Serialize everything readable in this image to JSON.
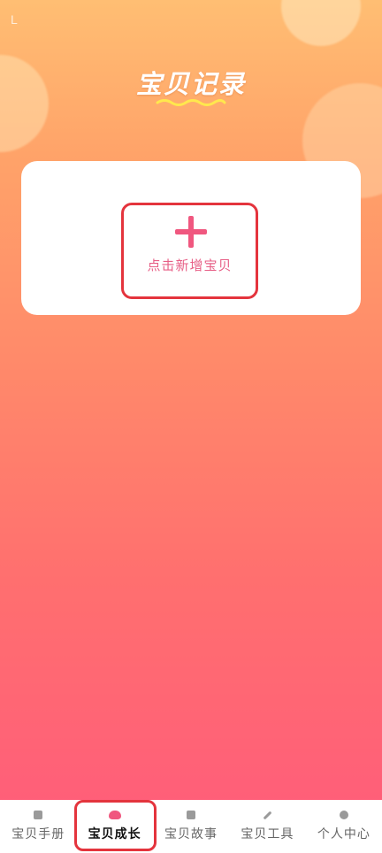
{
  "status_mark": "L",
  "page": {
    "title": "宝贝记录"
  },
  "add_baby": {
    "label": "点击新增宝贝",
    "icon": "plus-icon"
  },
  "tabbar": {
    "items": [
      {
        "label": "宝贝手册",
        "icon": "book-icon",
        "active": false
      },
      {
        "label": "宝贝成长",
        "icon": "growth-icon",
        "active": true
      },
      {
        "label": "宝贝故事",
        "icon": "story-icon",
        "active": false
      },
      {
        "label": "宝贝工具",
        "icon": "wrench-icon",
        "active": false
      },
      {
        "label": "个人中心",
        "icon": "profile-icon",
        "active": false
      }
    ]
  },
  "colors": {
    "accent": "#f0577f",
    "highlight": "#e4343d",
    "title": "#ffffff"
  }
}
